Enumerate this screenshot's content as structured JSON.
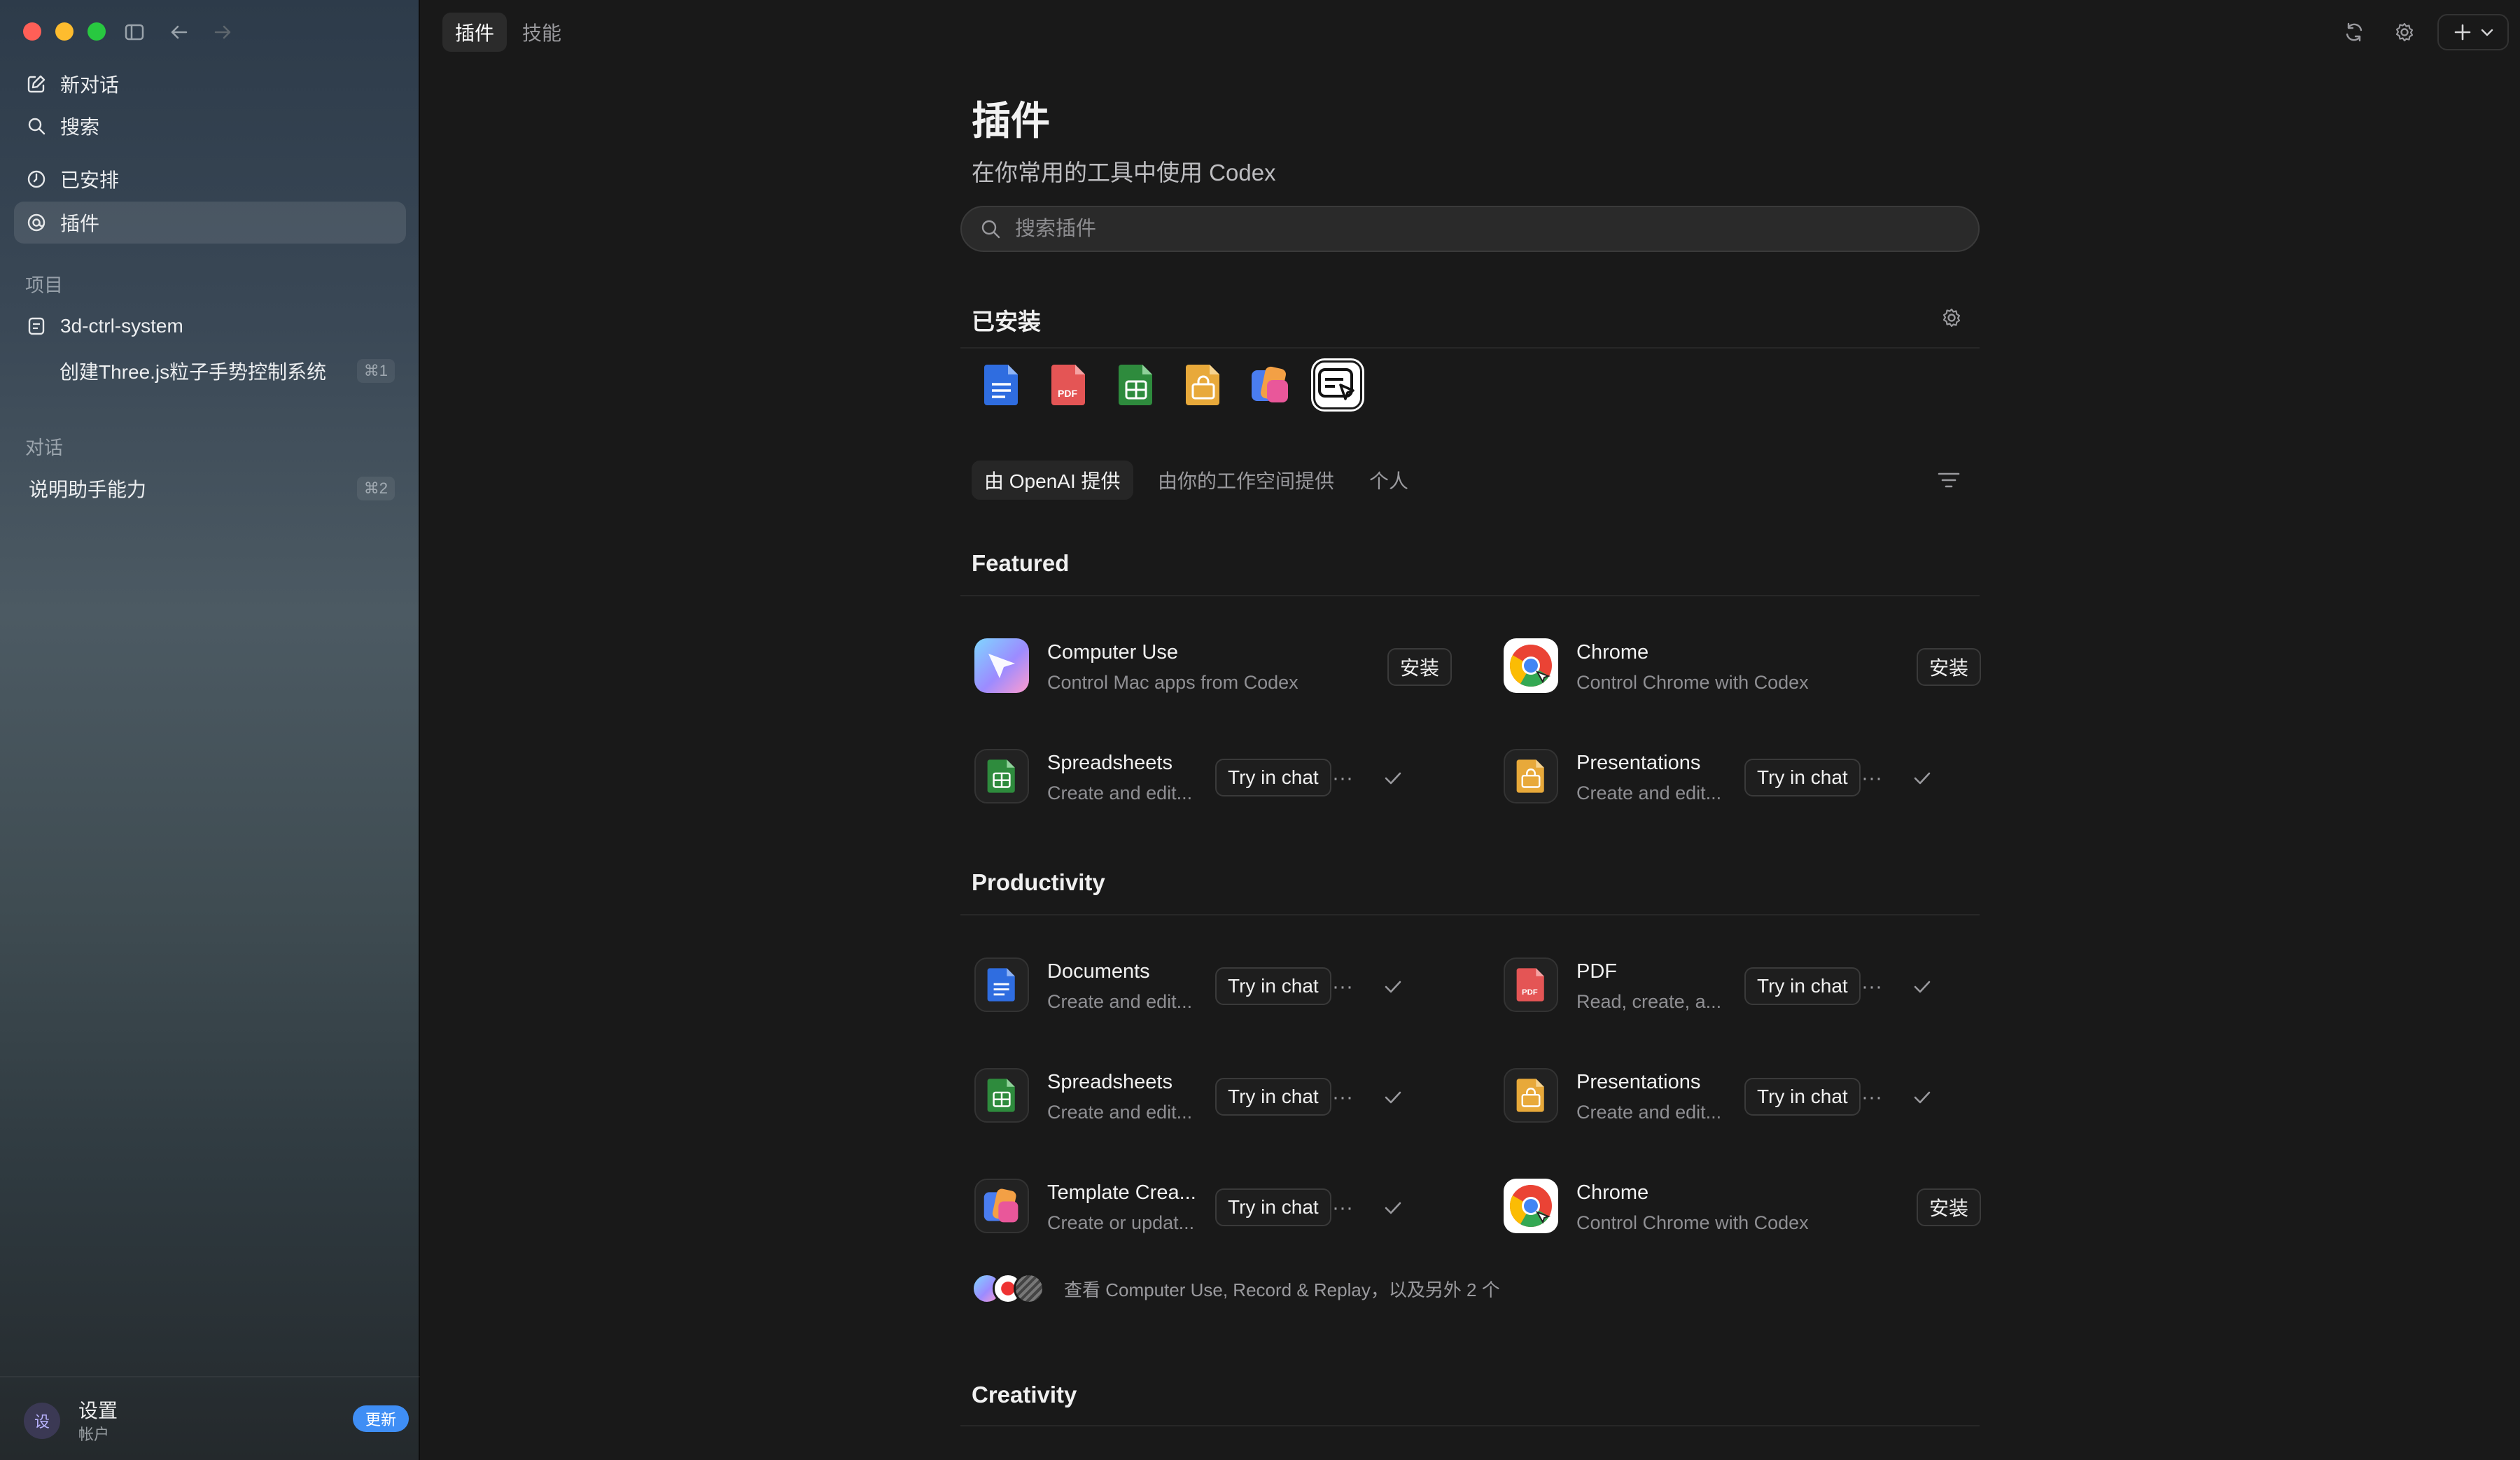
{
  "window": {
    "traffic_colors": [
      "#ff5f57",
      "#febc2e",
      "#28c840"
    ]
  },
  "sidebar": {
    "new_chat": "新对话",
    "search": "搜索",
    "scheduled": "已安排",
    "plugins": "插件",
    "projects_heading": "项目",
    "project_name": "3d-ctrl-system",
    "project_task": "创建Three.js粒子手势控制系统",
    "project_task_shortcut": "⌘1",
    "chats_heading": "对话",
    "chat_item": "说明助手能力",
    "chat_item_shortcut": "⌘2",
    "footer": {
      "avatar": "设",
      "title": "设置",
      "subtitle": "帐户",
      "update_badge": "更新"
    }
  },
  "topbar": {
    "tabs": [
      "插件",
      "技能"
    ],
    "active_tab": "插件"
  },
  "page": {
    "title": "插件",
    "subtitle": "在你常用的工具中使用 Codex",
    "search_placeholder": "搜索插件",
    "installed_heading": "已安装",
    "filter_tabs": [
      "由 OpenAI 提供",
      "由你的工作空间提供",
      "个人"
    ]
  },
  "featured": {
    "heading": "Featured",
    "cards": [
      {
        "name": "Computer Use",
        "desc": "Control Mac apps from Codex",
        "action": "安装"
      },
      {
        "name": "Chrome",
        "desc": "Control Chrome with Codex",
        "action": "安装"
      },
      {
        "name": "Spreadsheets",
        "desc": "Create and edit...",
        "action": "Try in chat"
      },
      {
        "name": "Presentations",
        "desc": "Create and edit...",
        "action": "Try in chat"
      }
    ]
  },
  "productivity": {
    "heading": "Productivity",
    "cards": [
      {
        "name": "Documents",
        "desc": "Create and edit...",
        "action": "Try in chat"
      },
      {
        "name": "PDF",
        "desc": "Read, create, a...",
        "action": "Try in chat"
      },
      {
        "name": "Spreadsheets",
        "desc": "Create and edit...",
        "action": "Try in chat"
      },
      {
        "name": "Presentations",
        "desc": "Create and edit...",
        "action": "Try in chat"
      },
      {
        "name": "Template Crea...",
        "desc": "Create or updat...",
        "action": "Try in chat"
      },
      {
        "name": "Chrome",
        "desc": "Control Chrome with Codex",
        "action": "安装"
      }
    ],
    "more_text": "查看 Computer Use, Record & Replay，以及另外 2 个"
  },
  "creativity": {
    "heading": "Creativity"
  },
  "icons": {
    "docs": "#2f6de0",
    "pdf": "#e45555",
    "sheets": "#2e8b3d",
    "slides": "#e8a93a",
    "chrome": [
      "#ea4335",
      "#fbbc04",
      "#34a853",
      "#4285f4"
    ]
  },
  "ellipsis": "···"
}
